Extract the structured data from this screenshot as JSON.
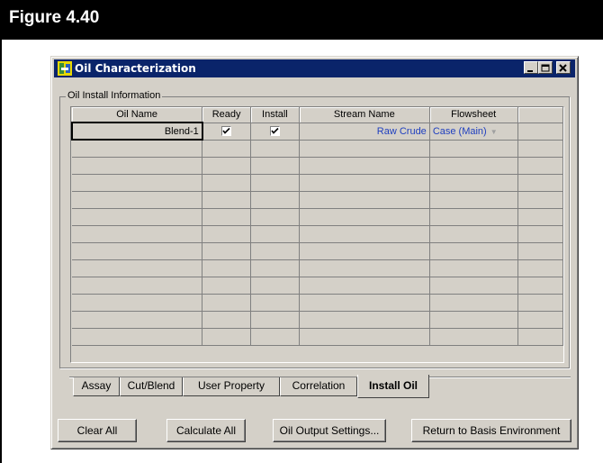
{
  "figure": {
    "title": "Figure 4.40"
  },
  "window": {
    "title": "Oil Characterization",
    "controls": [
      "minimize",
      "maximize",
      "close"
    ]
  },
  "group": {
    "label": "Oil Install Information"
  },
  "grid": {
    "columns": [
      "Oil Name",
      "Ready",
      "Install",
      "Stream Name",
      "Flowsheet",
      ""
    ],
    "rows": [
      {
        "oil_name": "Blend-1",
        "ready": true,
        "install": true,
        "stream_name": "Raw Crude",
        "flowsheet": "Case (Main)"
      }
    ],
    "empty_rows": 12
  },
  "tabs": [
    {
      "label": "Assay",
      "active": false
    },
    {
      "label": "Cut/Blend",
      "active": false
    },
    {
      "label": "User Property",
      "active": false
    },
    {
      "label": "Correlation",
      "active": false
    },
    {
      "label": "Install Oil",
      "active": true
    }
  ],
  "buttons": {
    "clear_all": "Clear All",
    "calculate_all": "Calculate All",
    "oil_output_settings": "Oil Output Settings...",
    "return_basis": "Return to Basis Environment"
  },
  "colors": {
    "titlebar": "#0a246a",
    "link_text": "#1f3fbf",
    "face": "#d4d0c8"
  }
}
